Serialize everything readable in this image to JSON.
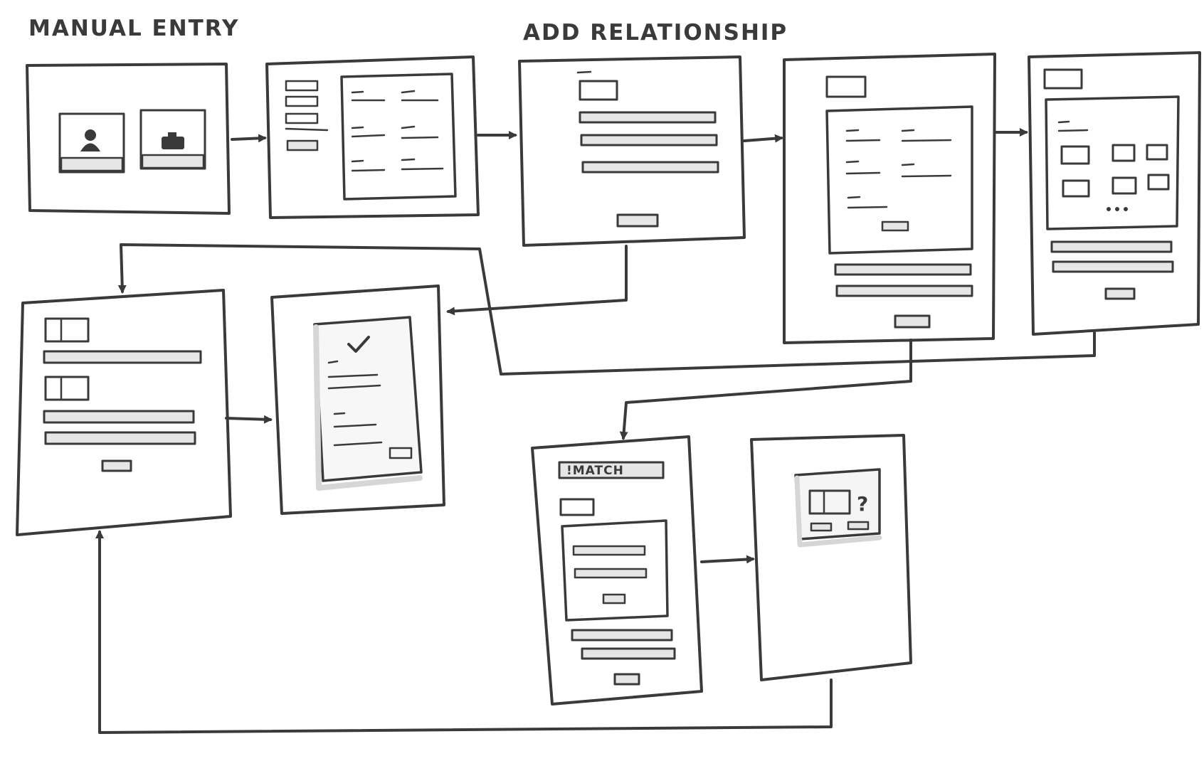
{
  "titles": {
    "manual_entry": "MANUAL ENTRY",
    "add_relationship": "ADD RELATIONSHIP"
  },
  "screens": {
    "match": {
      "badge": "!MATCH"
    },
    "confirm": {
      "question_mark": "?"
    }
  },
  "icons": {
    "person": "person-icon",
    "camera": "camera-icon",
    "check": "checkmark-icon",
    "ellipsis": "…"
  },
  "colors": {
    "ink": "#3a3a3a",
    "fill": "#e6e6e6",
    "paper": "#ffffff"
  }
}
